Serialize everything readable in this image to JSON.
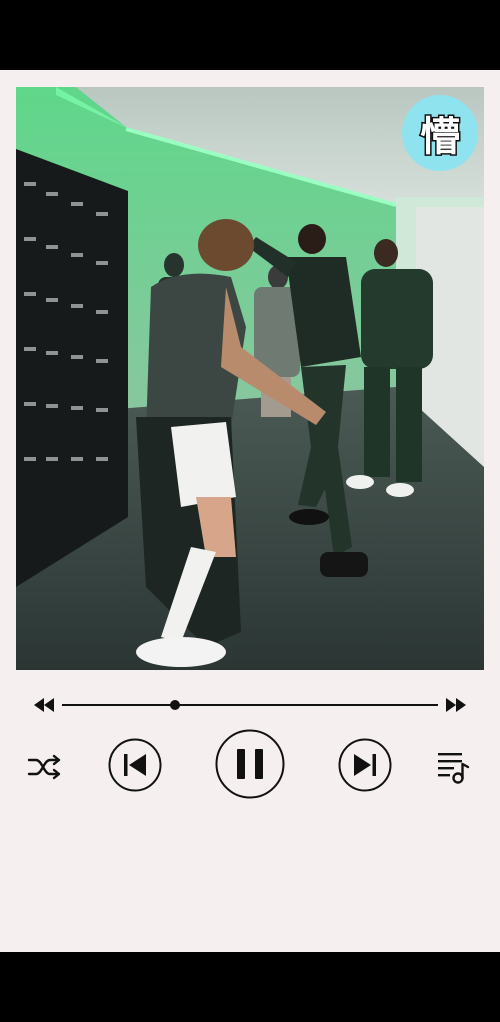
{
  "video": {
    "badge_text": "懵"
  },
  "player": {
    "progress_fraction": 0.3,
    "controls": {
      "rewind_icon": "rewind-icon",
      "fast_forward_icon": "fast-forward-icon",
      "shuffle_icon": "shuffle-icon",
      "previous_icon": "skip-previous-icon",
      "pause_icon": "pause-icon",
      "next_icon": "skip-next-icon",
      "playlist_icon": "playlist-music-icon"
    }
  },
  "colors": {
    "background": "#f5efef",
    "icon": "#111111",
    "badge": "#8fe3ef",
    "bars": "#000000"
  }
}
